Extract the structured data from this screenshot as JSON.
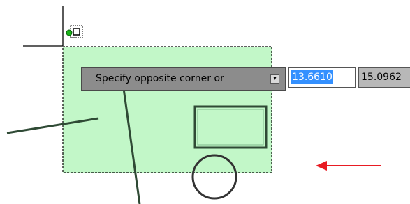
{
  "dynamic_input": {
    "prompt": "Specify opposite corner or",
    "options_arrow": "▾",
    "x_value": "13.6610",
    "y_value": "15.0962"
  },
  "colors": {
    "selection_fill": "#c2f7c8",
    "selection_border": "#000000",
    "geometry": "#2f4a35",
    "indicator_arrow": "#e81b23",
    "grip": "#18b318"
  },
  "icons": {
    "grip": "grip-icon",
    "pickbox": "pickbox-icon",
    "arrow": "red-arrow-icon"
  }
}
